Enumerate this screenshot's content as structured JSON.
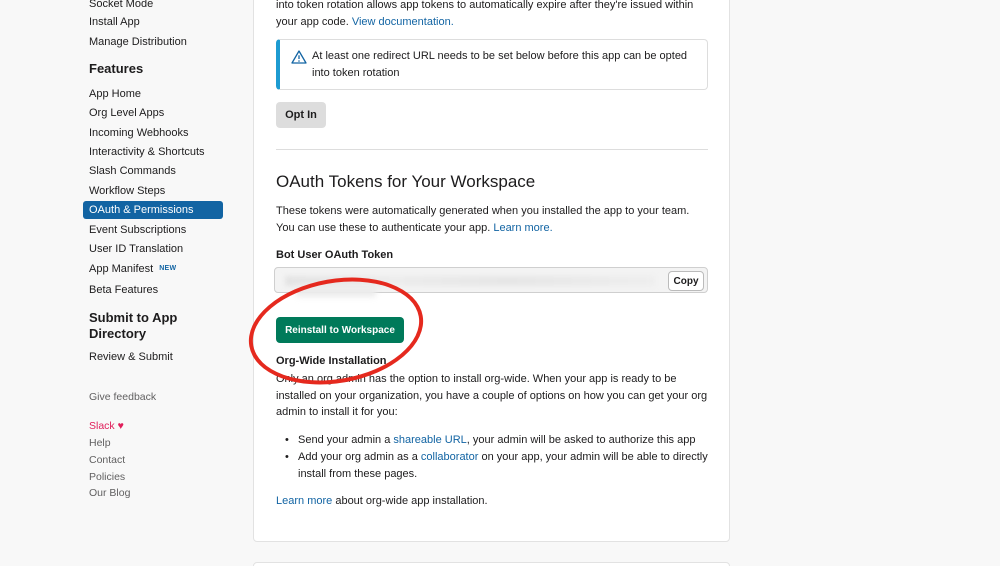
{
  "sidebar": {
    "top_items": [
      {
        "label": "Socket Mode"
      },
      {
        "label": "Install App"
      },
      {
        "label": "Manage Distribution"
      }
    ],
    "features_heading": "Features",
    "features": [
      {
        "label": "App Home"
      },
      {
        "label": "Org Level Apps"
      },
      {
        "label": "Incoming Webhooks"
      },
      {
        "label": "Interactivity & Shortcuts"
      },
      {
        "label": "Slash Commands"
      },
      {
        "label": "Workflow Steps"
      },
      {
        "label": "OAuth & Permissions",
        "active": true
      },
      {
        "label": "Event Subscriptions"
      },
      {
        "label": "User ID Translation"
      },
      {
        "label": "App Manifest",
        "badge": "NEW"
      },
      {
        "label": "Beta Features"
      }
    ],
    "submit_heading_line1": "Submit to App",
    "submit_heading_line2": "Directory",
    "review_submit": "Review & Submit",
    "give_feedback": "Give feedback",
    "footer": {
      "slack": "Slack",
      "heart": "♥",
      "links": [
        "Help",
        "Contact",
        "Policies",
        "Our Blog"
      ]
    }
  },
  "main": {
    "rotation_text_prefix": "into token rotation allows app tokens to automatically expire after they're issued within",
    "rotation_text_line2": "your app code.",
    "view_documentation": "View documentation.",
    "warning": {
      "icon": "warning-triangle-icon",
      "text": "At least one redirect URL needs to be set below before this app can be opted into token rotation"
    },
    "opt_in_button": "Opt In",
    "oauth_section": {
      "title": "OAuth Tokens for Your Workspace",
      "desc_line1": "These tokens were automatically generated when you installed the app to your team.",
      "desc_line2": "You can use these to authenticate your app.",
      "learn_more": "Learn more.",
      "token_label": "Bot User OAuth Token",
      "copy_button": "Copy",
      "reinstall_button": "Reinstall to Workspace"
    },
    "org_wide": {
      "title": "Org-Wide Installation",
      "desc_line1": "Only an org admin has the option to install org-wide. When your app is ready to be",
      "desc_line2": "installed on your organization, you have a couple of options on how you can get your org",
      "desc_line3": "admin to install it for you:",
      "bullet1_prefix": "Send your admin a",
      "bullet1_link": "shareable URL",
      "bullet1_suffix": ", your admin will be asked to authorize this app",
      "bullet2_prefix": "Add your org admin as a",
      "bullet2_link": "collaborator",
      "bullet2_suffix": "on your app, your admin will be able to directly install from these pages.",
      "learn_more_link": "Learn more",
      "learn_more_suffix": "about org-wide app installation."
    }
  },
  "colors": {
    "accent": "#1264a3",
    "primary_button": "#007a5a",
    "annotation_circle": "#e5291e",
    "warning_border": "#1d9bd1"
  }
}
